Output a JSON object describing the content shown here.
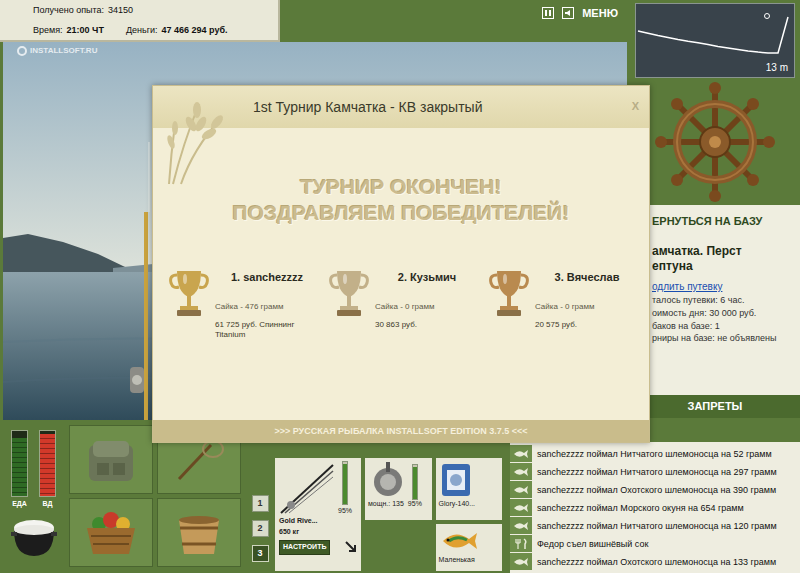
{
  "hud": {
    "experience": {
      "label": "Получено опыта:",
      "value": "34150"
    },
    "time": {
      "label": "Время:",
      "value": "21:00 ЧТ"
    },
    "money": {
      "label": "Деньги:",
      "value": "47 466 294 руб."
    }
  },
  "watermark": "INSTALLSOFT.RU",
  "toolbar": {
    "menu": "МЕНЮ"
  },
  "depth": {
    "reading": "13 m",
    "profile": [
      5.7,
      6.4,
      7.2,
      7.8,
      8.5,
      9.1,
      9.6,
      10.2,
      10.8,
      11.3,
      11.8,
      12.3,
      12.7,
      13,
      13,
      1
    ]
  },
  "base": {
    "return_button": "ЕРНУТЬСЯ НА БАЗУ",
    "title_lines": [
      "амчатка. Перст",
      "ептуна"
    ],
    "extend_link": "одлить путевку",
    "info": [
      "талось путевки: 6 час.",
      "оимость дня: 30 000 руб.",
      "баков на базе: 1",
      "рниры на базе: не объявлены"
    ],
    "bans": "ЗАПРЕТЫ"
  },
  "modal": {
    "title": "1st Турнир Камчатка - КВ закрытый",
    "close": "X",
    "headline": [
      "ТУРНИР ОКОНЧЕН!",
      "ПОЗДРАВЛЯЕМ ПОБЕДИТЕЛЕЙ!"
    ],
    "winners": [
      {
        "place": "1. sanchezzzz",
        "catch": "Сайка - 476 грамм",
        "prize": "61 725 руб. Спиннинг Titanium",
        "color": "#c9a54e"
      },
      {
        "place": "2. Кузьмич",
        "catch": "Сайка - 0 грамм",
        "prize": "30 863 руб.",
        "color": "#c2b089"
      },
      {
        "place": "3. Вячеслав",
        "catch": "Сайка - 0 грамм",
        "prize": "20 575 руб.",
        "color": "#b98a4f"
      }
    ],
    "footer": ">>> РУССКАЯ РЫБАЛКА INSTALLSOFT EDITION 3.7.5 <<<"
  },
  "bottom": {
    "gauges": [
      {
        "label": "ЕДА",
        "level": 0.9,
        "color": "#2f6a24"
      },
      {
        "label": "ВД",
        "level": 0.95,
        "color": "#d2392a"
      }
    ],
    "slots": [
      {
        "label": "1",
        "selected": false
      },
      {
        "label": "2",
        "selected": false
      },
      {
        "label": "3",
        "selected": true
      }
    ],
    "rod": {
      "name": "Gold Rive...",
      "load": "650 кг",
      "wear": "95%",
      "level": 0.95,
      "button": "НАСТРОИТЬ"
    },
    "reel": {
      "power": "мощн.: 135",
      "wear": "95%",
      "level": 0.95
    },
    "line": {
      "name": "Glory-140..."
    },
    "lure": {
      "name": "Маленькая"
    }
  },
  "log": [
    {
      "text": "sanchezzzz поймал Нитчатого шлемоносца на 52 грамм",
      "kind": "catch"
    },
    {
      "text": "sanchezzzz поймал Нитчатого шлемоносца на 297 грамм",
      "kind": "catch"
    },
    {
      "text": "sanchezzzz поймал Охотского шлемоносца на 390 грамм",
      "kind": "catch"
    },
    {
      "text": "sanchezzzz поймал Морского окуня на 654 грамм",
      "kind": "catch"
    },
    {
      "text": "sanchezzzz поймал Нитчатого шлемоносца на 120 грамм",
      "kind": "catch"
    },
    {
      "text": "Федор съел вишнёвый сок",
      "kind": "eat"
    },
    {
      "text": "sanchezzzz поймал Охотского шлемоносца на 133 грамм",
      "kind": "catch"
    }
  ]
}
